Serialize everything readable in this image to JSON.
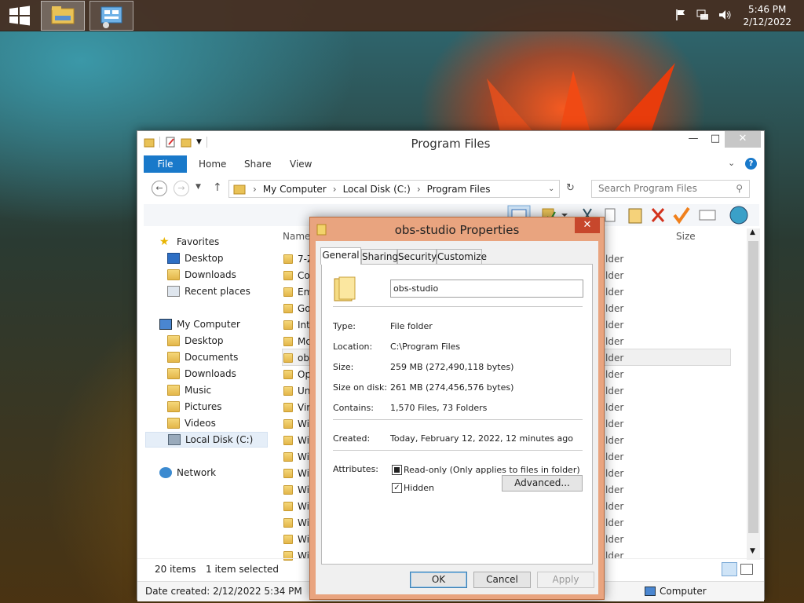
{
  "taskbar": {
    "clock_time": "5:46 PM",
    "clock_date": "2/12/2022"
  },
  "explorer": {
    "title": "Program Files",
    "ribbon_tabs": [
      "File",
      "Home",
      "Share",
      "View"
    ],
    "address": [
      "My Computer",
      "Local Disk (C:)",
      "Program Files"
    ],
    "search_placeholder": "Search Program Files",
    "nav": {
      "favorites": "Favorites",
      "fav_items": [
        "Desktop",
        "Downloads",
        "Recent places"
      ],
      "computer": "My Computer",
      "computer_items": [
        "Desktop",
        "Documents",
        "Downloads",
        "Music",
        "Pictures",
        "Videos",
        "Local Disk (C:)"
      ],
      "network": "Network"
    },
    "col_name": "Name",
    "col_size": "Size",
    "files": [
      "7-Z",
      "Co",
      "Em",
      "Go",
      "Int",
      "Mo",
      "obs",
      "Op",
      "Un",
      "Vir",
      "Wi",
      "Wi",
      "Wi",
      "Wi",
      "Wi",
      "Wi",
      "Wi",
      "Wi",
      "Wi"
    ],
    "type_fragment": "lder",
    "status_items": "20 items",
    "status_selected": "1 item selected",
    "status_date": "Date created: 2/12/2022 5:34 PM",
    "status_computer": "Computer"
  },
  "dialog": {
    "title": "obs-studio Properties",
    "tabs": [
      "General",
      "Sharing",
      "Security",
      "Customize"
    ],
    "folder_name": "obs-studio",
    "rows": {
      "type_label": "Type:",
      "type_value": "File folder",
      "location_label": "Location:",
      "location_value": "C:\\Program Files",
      "size_label": "Size:",
      "size_value": "259 MB (272,490,118 bytes)",
      "disk_label": "Size on disk:",
      "disk_value": "261 MB (274,456,576 bytes)",
      "contains_label": "Contains:",
      "contains_value": "1,570 Files, 73 Folders",
      "created_label": "Created:",
      "created_value": "Today, February 12, 2022, 12 minutes ago",
      "attributes_label": "Attributes:"
    },
    "readonly_label": "Read-only (Only applies to files in folder)",
    "hidden_label": "Hidden",
    "advanced_label": "Advanced...",
    "ok_label": "OK",
    "cancel_label": "Cancel",
    "apply_label": "Apply"
  }
}
